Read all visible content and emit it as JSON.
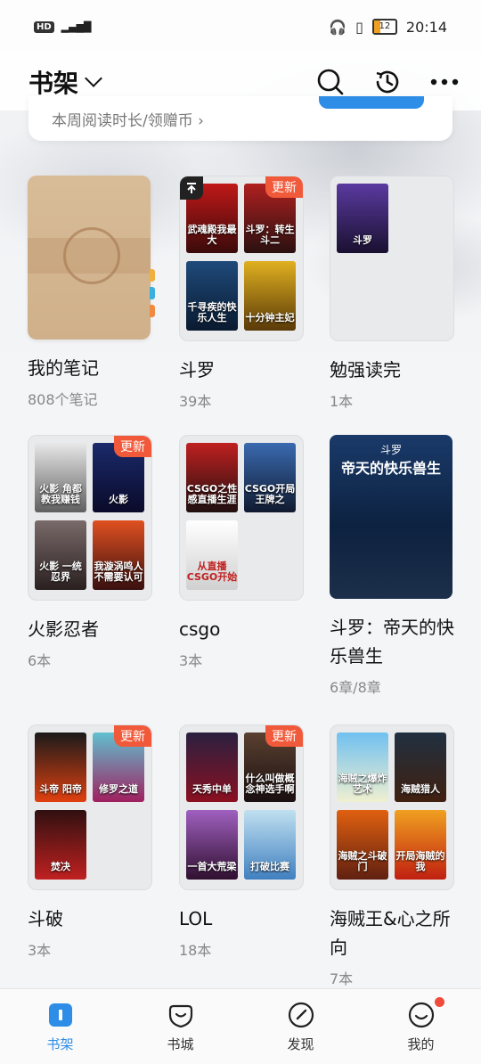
{
  "statusbar": {
    "left": "HD 2  5G",
    "battery": "12",
    "time": "20:14"
  },
  "header": {
    "title": "书架"
  },
  "banner": {
    "text": "本周阅读时长/领赠币 ›"
  },
  "shelf": {
    "notes": {
      "name": "我的笔记",
      "count": "808个笔记"
    },
    "douluo": {
      "name": "斗罗",
      "count": "39本",
      "badge": "更新",
      "covers": [
        "武魂殿我最大",
        "斗罗：转生斗二",
        "千寻疾的快乐人生",
        "十分钟主妃"
      ]
    },
    "mianqiang": {
      "name": "勉强读完",
      "count": "1本",
      "covers": [
        "斗罗"
      ]
    },
    "huoying": {
      "name": "火影忍者",
      "count": "6本",
      "badge": "更新",
      "covers": [
        "火影 角都教我赚钱",
        "火影",
        "火影 一统忍界",
        "我漩涡鸣人 不需要认可"
      ]
    },
    "csgo": {
      "name": "csgo",
      "count": "3本",
      "covers": [
        "CSGO之性感直播生涯",
        "CSGO开局王牌之",
        "从直播CSGO开始"
      ]
    },
    "douluo_single": {
      "name": "斗罗：帝天的快乐兽生",
      "count": "6章/8章",
      "cover_top": "斗罗",
      "cover_title": "帝天的快乐兽生"
    },
    "doupo": {
      "name": "斗破",
      "count": "3本",
      "badge": "更新",
      "covers": [
        "斗帝 阳帝",
        "修罗之道",
        "焚决"
      ]
    },
    "lol": {
      "name": "LOL",
      "count": "18本",
      "badge": "更新",
      "covers": [
        "天秀中单",
        "什么叫做概念神选手啊",
        "一首大荒梁",
        "打破比赛"
      ]
    },
    "haizeiwang": {
      "name": "海贼王&心之所向",
      "count": "7本",
      "covers": [
        "海贼之爆炸艺术",
        "海贼猎人",
        "海贼之斗破门",
        "开局海贼的我"
      ]
    }
  },
  "nav": {
    "items": [
      {
        "label": "书架"
      },
      {
        "label": "书城"
      },
      {
        "label": "发现"
      },
      {
        "label": "我的"
      }
    ]
  },
  "colors": {
    "accent": "#2e8de6",
    "badge": "#f05a3a"
  }
}
